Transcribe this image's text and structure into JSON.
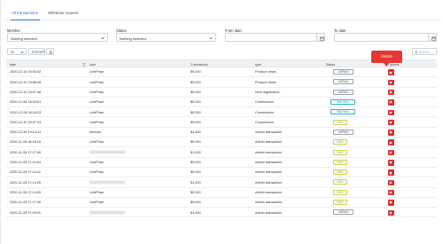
{
  "tabs": [
    {
      "label": "All transactions"
    },
    {
      "label": "Withdraw request"
    }
  ],
  "filters": {
    "member_label": "Member",
    "member_value": "Nothing selected",
    "status_label": "Status",
    "status_value": "Nothing selected",
    "from_label": "From date",
    "from_value": "",
    "to_label": "To date",
    "to_value": ""
  },
  "controls": {
    "page_size": "25",
    "export_label": "EXPORT",
    "search_placeholder": "Search..."
  },
  "columns": [
    "date",
    "user",
    "Commission",
    "type",
    "Status",
    "Options"
  ],
  "rows": [
    {
      "date": "2020-12-14 00:00:52",
      "user": "LinhPhan",
      "commission": "$9,000",
      "type": "Product views",
      "status": "UNPAID"
    },
    {
      "date": "2020-12-10 23:58:45",
      "user": "LinhPhan",
      "commission": "$9,000",
      "type": "Product views",
      "status": "UNPAID"
    },
    {
      "date": "2020-12-10 23:47:46",
      "user": "LinhPhan",
      "commission": "$9,000",
      "type": "New registration",
      "status": "UNPAID"
    },
    {
      "date": "2020-12-08 16:20:51",
      "user": "LinhPhan",
      "commission": "$9,000",
      "type": "Commission",
      "status": "WAITING"
    },
    {
      "date": "2020-12-08 16:18:23",
      "user": "LinhPhan",
      "commission": "$9,000",
      "type": "Commission",
      "status": "WAITING"
    },
    {
      "date": "2020-12-10 20:07:03",
      "user": "LinhPhan",
      "commission": "$9,000",
      "type": "Commission",
      "status": "PAID"
    },
    {
      "date": "2020-12-26 19:14:31",
      "user": "benhan",
      "commission": "$1,400",
      "type": "Admin transaction",
      "status": "UNPAID"
    },
    {
      "date": "2020-11-28 18:16:18",
      "user": "LinhPhan",
      "commission": "$9,000",
      "type": "Admin transaction",
      "status": "PAID"
    },
    {
      "date": "2020-11-28 17:17:49",
      "user": "",
      "commission": "$1,400",
      "type": "Admin transaction",
      "status": "PAID"
    },
    {
      "date": "2020-11-28 17:14:34",
      "user": "LinhPhan",
      "commission": "$9,000",
      "type": "Admin transaction",
      "status": "PAID"
    },
    {
      "date": "2020-11-28 17:14:41",
      "user": "LinhPhan",
      "commission": "$9,000",
      "type": "Admin transaction",
      "status": "PAID"
    },
    {
      "date": "2020-11-28 17:14:25",
      "user": "",
      "commission": "$1,400",
      "type": "Admin transaction",
      "status": "PAID"
    },
    {
      "date": "2020-11-28 17:14:09",
      "user": "LinhPhan",
      "commission": "$9,000",
      "type": "Admin transaction",
      "status": "PAID"
    },
    {
      "date": "2020-11-28 17:17:06",
      "user": "LinhPhan",
      "commission": "$9,000",
      "type": "Admin transaction",
      "status": "PAID"
    },
    {
      "date": "2020-11-28 17:09:01",
      "user": "",
      "commission": "$1,400",
      "type": "Admin transaction",
      "status": "UNPAID"
    }
  ],
  "tooltip": {
    "label": "delete"
  },
  "colors": {
    "accent": "#2f6fd6",
    "danger": "#d32f2f",
    "tooltip": "#e53935"
  }
}
